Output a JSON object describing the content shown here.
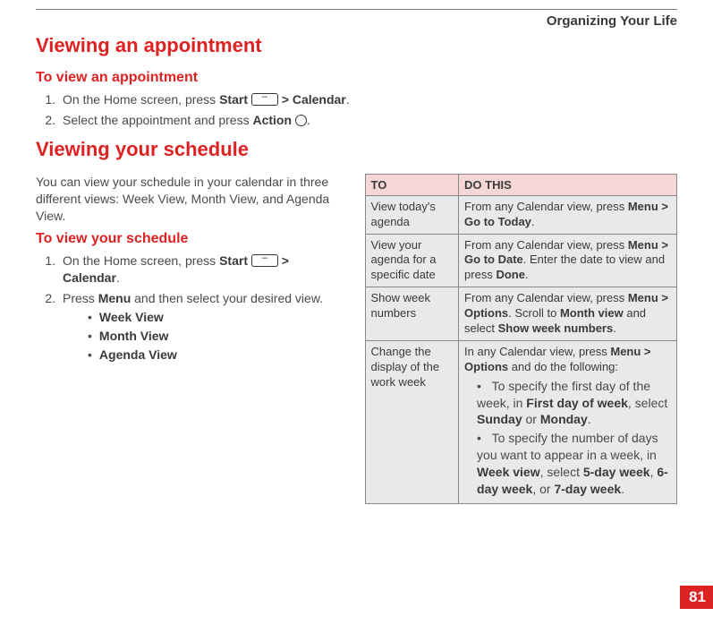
{
  "chapter_title": "Organizing Your Life",
  "h1_viewing_appointment": "Viewing an appointment",
  "h2_to_view_appointment": "To view an appointment",
  "step_a1_pre": "On the Home screen, press ",
  "label_start": "Start",
  "gt": " > ",
  "label_calendar": "Calendar",
  "step_a2_pre": "Select the appointment and press ",
  "label_action": "Action",
  "h1_viewing_schedule": "Viewing your schedule",
  "schedule_intro": "You can view your schedule in your calendar in three different views: Week View, Month View, and Agenda View.",
  "h2_to_view_schedule": "To view your schedule",
  "step_b1_pre": "On the Home screen, press ",
  "step_b2_pre": "Press ",
  "label_menu": "Menu",
  "step_b2_post": " and then select your desired view.",
  "views": {
    "week": "Week View",
    "month": "Month View",
    "agenda": "Agenda View"
  },
  "table": {
    "head_to": "TO",
    "head_do": "DO THIS",
    "rows": [
      {
        "to": "View today's agenda",
        "do_pre": "From any Calendar view, press ",
        "bold1": "Menu > Go to Today",
        "do_post": "."
      },
      {
        "to": "View your agenda for a specific date",
        "do_pre": "From any Calendar view, press ",
        "bold1": "Menu > Go to Date",
        "do_mid": ". Enter the date to view and press ",
        "bold2": "Done",
        "do_post": "."
      },
      {
        "to": "Show week numbers",
        "do_pre": "From any Calendar view, press ",
        "bold1": "Menu > Options",
        "do_mid1": ". Scroll to ",
        "bold2": "Month view",
        "do_mid2": " and select ",
        "bold3": "Show week numbers",
        "do_post": "."
      },
      {
        "to": "Change the display of the work week",
        "do_pre": "In any Calendar view, press ",
        "bold1": "Menu > Options",
        "do_mid": " and do the following:",
        "bullets": [
          {
            "pre": "To specify the first day of the week, in ",
            "b1": "First day of week",
            "mid1": ", select ",
            "b2": "Sunday",
            "mid2": " or ",
            "b3": "Monday",
            "post": "."
          },
          {
            "pre": "To specify the number of days you want to appear in a week, in ",
            "b1": "Week view",
            "mid1": ", select ",
            "b2": "5-day week",
            "mid2": ", ",
            "b3": "6-day week",
            "mid3": ", or ",
            "b4": "7-day week",
            "post": "."
          }
        ]
      }
    ]
  },
  "page_number": "81"
}
